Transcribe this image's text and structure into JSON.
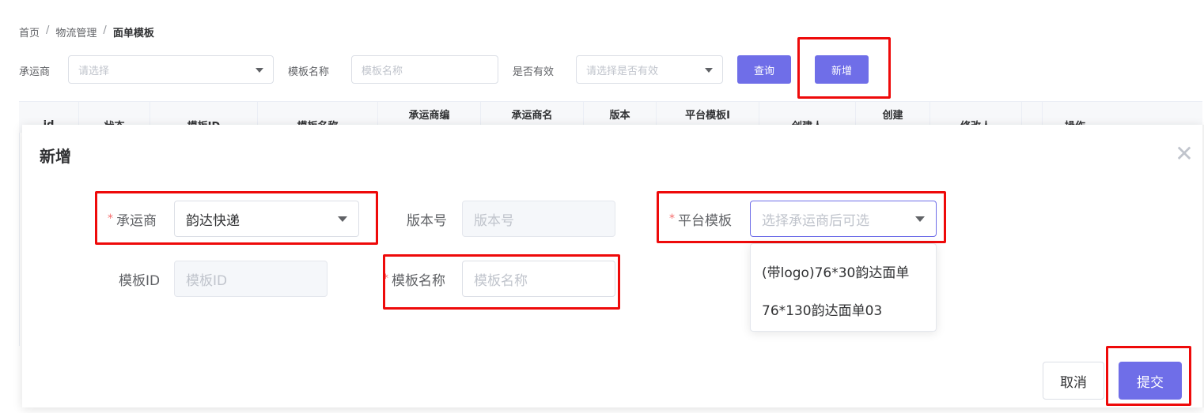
{
  "breadcrumb": {
    "home": "首页",
    "section": "物流管理",
    "current": "面单模板",
    "separator": "/"
  },
  "filters": {
    "carrier_label": "承运商",
    "carrier_placeholder": "请选择",
    "template_name_label": "模板名称",
    "template_name_placeholder": "模板名称",
    "valid_label": "是否有效",
    "valid_placeholder": "请选择是否有效",
    "query_button": "查询",
    "add_button": "新增"
  },
  "table": {
    "columns": [
      [
        "id"
      ],
      [
        "状态"
      ],
      [
        "模板ID"
      ],
      [
        "模板名称"
      ],
      [
        "承运商编"
      ],
      [
        "承运商名"
      ],
      [
        "版本"
      ],
      [
        "平台模板I"
      ],
      [
        "创建人"
      ],
      [
        "创建"
      ],
      [
        "修改人"
      ],
      [
        ""
      ],
      [
        "操作"
      ]
    ]
  },
  "modal": {
    "title": "新增",
    "close_icon": "close-icon",
    "carrier_label": "承运商",
    "carrier_value": "韵达快递",
    "version_label": "版本号",
    "version_placeholder": "版本号",
    "platform_template_label": "平台模板",
    "platform_template_placeholder": "选择承运商后可选",
    "template_id_label": "模板ID",
    "template_id_placeholder": "模板ID",
    "template_name_label": "模板名称",
    "template_name_placeholder": "模板名称",
    "required_mark": "*",
    "dropdown_options": [
      "(带logo)76*30韵达面单",
      "76*130韵达面单03"
    ],
    "cancel_button": "取消",
    "submit_button": "提交"
  },
  "colors": {
    "primary": "#6f6ee8",
    "highlight": "#ee0a0a",
    "required": "#f56c6c"
  }
}
